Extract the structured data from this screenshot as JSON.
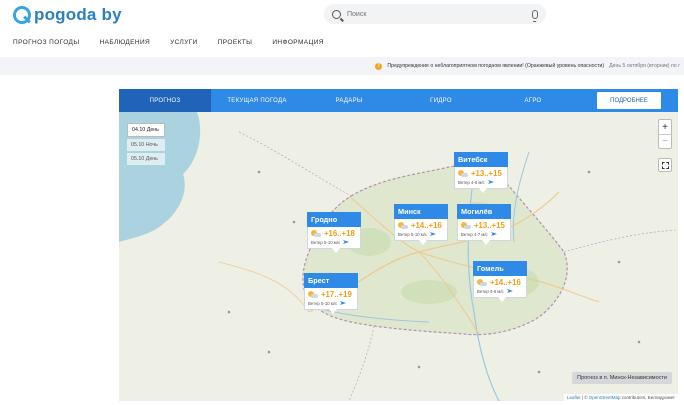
{
  "header": {
    "logo_text": "pogoda by",
    "search": {
      "placeholder": "Поиск"
    }
  },
  "nav": {
    "items": [
      "ПРОГНОЗ ПОГОДЫ",
      "НАБЛЮДЕНИЯ",
      "УСЛУГИ",
      "ПРОЕКТЫ",
      "ИНФОРМАЦИЯ"
    ]
  },
  "alert": {
    "icon": "!",
    "text": "Предупреждение о неблагоприятном погодном явлении! (Оранжевый уровень опасности)",
    "date": "День 5 октября (вторник) по г"
  },
  "widget": {
    "tabs": [
      "ПРОГНОЗ",
      "ТЕКУЩАЯ ПОГОДА",
      "РАДАРЫ",
      "ГИДРО",
      "АГРО"
    ],
    "active_tab": "ПРОГНОЗ",
    "detail_button": "ПОДРОБНЕЕ",
    "days": [
      "04.10 День",
      "05.10 Ночь",
      "05.10 День"
    ],
    "zoom_in": "+",
    "zoom_out": "−",
    "caption": "Прогноз в п. Минск-Независимости",
    "attribution_link1": "Leaflet",
    "attribution_link2": "OpenStreetMap",
    "attribution_text": "contributors, Белгидромет",
    "cities": {
      "vitebsk": {
        "name": "Витебск",
        "temp": "+13..+15",
        "wind": "Ветер 4-6 м/с"
      },
      "grodno": {
        "name": "Гродно",
        "temp": "+16..+18",
        "wind": "Ветер 5-10 м/с"
      },
      "minsk": {
        "name": "Минск",
        "temp": "+14..+16",
        "wind": "Ветер 5-10 м/с"
      },
      "mogilev": {
        "name": "Могилёв",
        "temp": "+13..+15",
        "wind": "Ветер 4-7 м/с"
      },
      "gomel": {
        "name": "Гомель",
        "temp": "+14..+16",
        "wind": "Ветер 4-6 м/с"
      },
      "brest": {
        "name": "Брест",
        "temp": "+17..+19",
        "wind": "Ветер 5-10 м/с"
      }
    }
  },
  "colors": {
    "brand": "#2e8ae6",
    "active_tab": "#1f64b8",
    "temp": "#f39c12",
    "alert": "#f5a524"
  }
}
